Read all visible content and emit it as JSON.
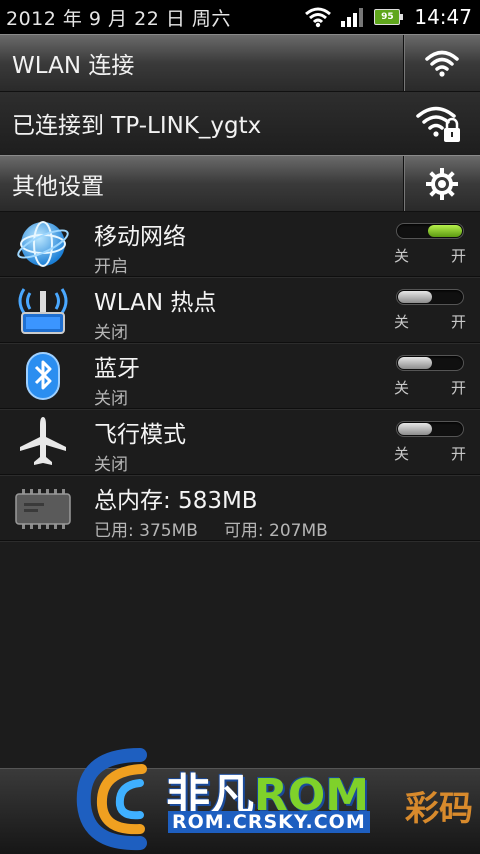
{
  "status": {
    "date": "2012 年 9 月 22 日 周六",
    "battery": "95",
    "time": "14:47"
  },
  "wlan_header": {
    "title": "WLAN 连接",
    "icon": "wifi-icon"
  },
  "connection": {
    "text": "已连接到 TP-LINK_ygtx",
    "icon": "wifi-lock-icon"
  },
  "other_header": {
    "title": "其他设置",
    "icon": "gear-icon"
  },
  "rows": [
    {
      "title": "移动网络",
      "status": "开启",
      "toggle_on": true,
      "icon": "globe-icon"
    },
    {
      "title": "WLAN 热点",
      "status": "关闭",
      "toggle_on": false,
      "icon": "hotspot-icon"
    },
    {
      "title": "蓝牙",
      "status": "关闭",
      "toggle_on": false,
      "icon": "bluetooth-icon"
    },
    {
      "title": "飞行模式",
      "status": "关闭",
      "toggle_on": false,
      "icon": "airplane-icon"
    }
  ],
  "toggle_labels": {
    "off": "关",
    "on": "开"
  },
  "storage": {
    "title": "总内存: 583MB",
    "used": "已用: 375MB",
    "available": "可用: 207MB",
    "icon": "memory-chip-icon"
  },
  "watermark": {
    "brand_white": "非凡",
    "brand_green": "ROM",
    "url": "ROM.CRSKY.COM",
    "right_text": "彩码"
  },
  "colors": {
    "toggle_on": "#7fd12a",
    "accent_blue": "#1e5fc0"
  }
}
